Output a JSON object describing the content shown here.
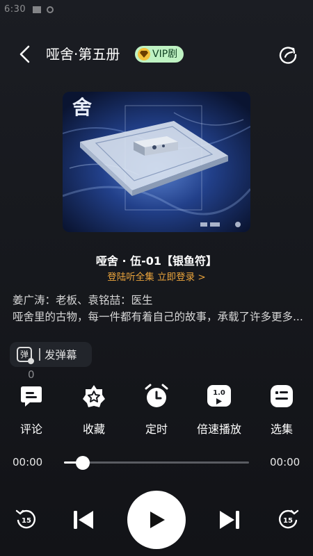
{
  "status_bar": {
    "time": "6:30"
  },
  "header": {
    "title": "哑舍·第五册",
    "vip_badge": "VIP剧"
  },
  "player": {
    "episode_title": "哑舍 · 伍-01【银鱼符】",
    "login_prompt": "登陆听全集",
    "login_link": "立即登录 >",
    "cast": "姜广涛：老板、袁铭喆：医生",
    "description": "哑舍里的古物，每一件都有着自己的故事，承载了许多更多...",
    "danmu_button": "发弹幕",
    "danmu_icon_char": "弹",
    "comment_count": "0",
    "current_time": "00:00",
    "total_time": "00:00",
    "progress_fraction": 0.0
  },
  "actions": [
    {
      "label": "评论",
      "icon": "comment-icon"
    },
    {
      "label": "收藏",
      "icon": "star-icon"
    },
    {
      "label": "定时",
      "icon": "alarm-clock-icon"
    },
    {
      "label": "倍速播放",
      "icon": "speed-icon",
      "badge": "1.0"
    },
    {
      "label": "选集",
      "icon": "episode-list-icon"
    }
  ],
  "controls": {
    "rewind_seconds": "15",
    "forward_seconds": "15"
  },
  "colors": {
    "accent_orange": "#e9a33c",
    "vip_green": "#bff2c3",
    "background": "#17191e"
  }
}
